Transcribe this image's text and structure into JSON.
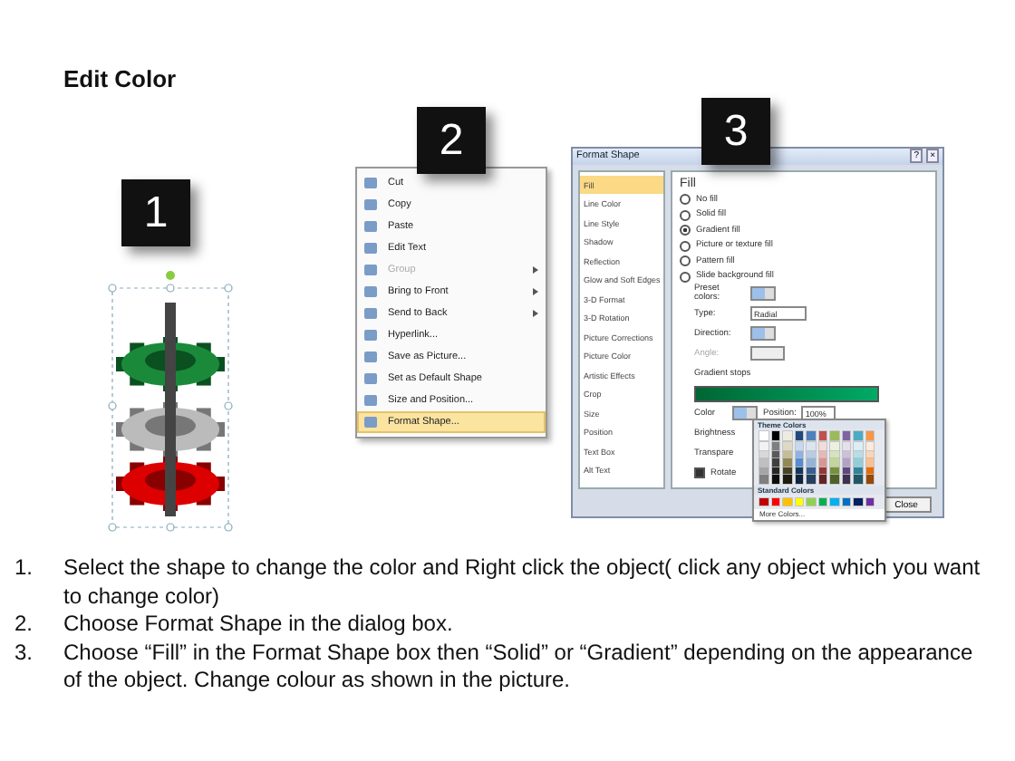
{
  "title": "Edit Color",
  "shape": {
    "badge": "1"
  },
  "context_menu": {
    "badge": "2",
    "items": [
      {
        "label": "Cut",
        "disabled": false,
        "submenu": false,
        "highlighted": false
      },
      {
        "label": "Copy",
        "disabled": false,
        "submenu": false,
        "highlighted": false
      },
      {
        "label": "Paste",
        "disabled": false,
        "submenu": false,
        "highlighted": false
      },
      {
        "label": "Edit Text",
        "disabled": false,
        "submenu": false,
        "highlighted": false
      },
      {
        "label": "Group",
        "disabled": true,
        "submenu": true,
        "highlighted": false
      },
      {
        "label": "Bring to Front",
        "disabled": false,
        "submenu": true,
        "highlighted": false
      },
      {
        "label": "Send to Back",
        "disabled": false,
        "submenu": true,
        "highlighted": false
      },
      {
        "label": "Hyperlink...",
        "disabled": false,
        "submenu": false,
        "highlighted": false
      },
      {
        "label": "Save as Picture...",
        "disabled": false,
        "submenu": false,
        "highlighted": false
      },
      {
        "label": "Set as Default Shape",
        "disabled": false,
        "submenu": false,
        "highlighted": false
      },
      {
        "label": "Size and Position...",
        "disabled": false,
        "submenu": false,
        "highlighted": false
      },
      {
        "label": "Format Shape...",
        "disabled": false,
        "submenu": false,
        "highlighted": true
      }
    ]
  },
  "dialog": {
    "badge": "3",
    "title": "Format Shape",
    "help": "?",
    "close": "×",
    "categories": [
      {
        "label": "Fill",
        "selected": true
      },
      {
        "label": "Line Color",
        "selected": false
      },
      {
        "label": "Line Style",
        "selected": false
      },
      {
        "label": "Shadow",
        "selected": false
      },
      {
        "label": "Reflection",
        "selected": false
      },
      {
        "label": "Glow and Soft Edges",
        "selected": false
      },
      {
        "label": "3-D Format",
        "selected": false
      },
      {
        "label": "3-D Rotation",
        "selected": false
      },
      {
        "label": "Picture Corrections",
        "selected": false
      },
      {
        "label": "Picture Color",
        "selected": false
      },
      {
        "label": "Artistic Effects",
        "selected": false
      },
      {
        "label": "Crop",
        "selected": false
      },
      {
        "label": "Size",
        "selected": false
      },
      {
        "label": "Position",
        "selected": false
      },
      {
        "label": "Text Box",
        "selected": false
      },
      {
        "label": "Alt Text",
        "selected": false
      }
    ],
    "section": "Fill",
    "fill_options": [
      {
        "label": "No fill",
        "selected": false
      },
      {
        "label": "Solid fill",
        "selected": false
      },
      {
        "label": "Gradient fill",
        "selected": true
      },
      {
        "label": "Picture or texture fill",
        "selected": false
      },
      {
        "label": "Pattern fill",
        "selected": false
      },
      {
        "label": "Slide background fill",
        "selected": false
      }
    ],
    "preset_label": "Preset colors:",
    "type_label": "Type:",
    "type_value": "Radial",
    "direction_label": "Direction:",
    "angle_label": "Angle:",
    "gradient_stops_label": "Gradient stops",
    "color_label": "Color",
    "position_label": "Position:",
    "position_value": "100%",
    "brightness_label": "Brightness",
    "transparency_label": "Transpare",
    "rotate": {
      "label": "Rotate",
      "checked": true
    },
    "close_button": "Close",
    "palette": {
      "theme_title": "Theme Colors",
      "theme_rows": [
        [
          {
            "color": "#ffffff"
          },
          {
            "color": "#000000"
          },
          {
            "color": "#eeece1"
          },
          {
            "color": "#1f497d"
          },
          {
            "color": "#4f81bd"
          },
          {
            "color": "#c0504d"
          },
          {
            "color": "#9bbb59"
          },
          {
            "color": "#8064a2"
          },
          {
            "color": "#4bacc6"
          },
          {
            "color": "#f79646"
          }
        ],
        [
          {
            "color": "#f2f2f2"
          },
          {
            "color": "#7f7f7f"
          },
          {
            "color": "#ddd9c3"
          },
          {
            "color": "#c6d9f0"
          },
          {
            "color": "#dbe5f1"
          },
          {
            "color": "#f2dcdb"
          },
          {
            "color": "#ebf1dd"
          },
          {
            "color": "#e5e0ec"
          },
          {
            "color": "#dbeef3"
          },
          {
            "color": "#fdeada"
          }
        ],
        [
          {
            "color": "#d8d8d8"
          },
          {
            "color": "#595959"
          },
          {
            "color": "#c4bd97"
          },
          {
            "color": "#8db3e2"
          },
          {
            "color": "#b8cce4"
          },
          {
            "color": "#e5b9b7"
          },
          {
            "color": "#d7e3bc"
          },
          {
            "color": "#ccc1d9"
          },
          {
            "color": "#b7dde8"
          },
          {
            "color": "#fbd5b5"
          }
        ],
        [
          {
            "color": "#bfbfbf"
          },
          {
            "color": "#3f3f3f"
          },
          {
            "color": "#938953"
          },
          {
            "color": "#548dd4"
          },
          {
            "color": "#95b3d7"
          },
          {
            "color": "#d99694"
          },
          {
            "color": "#c3d69b"
          },
          {
            "color": "#b2a2c7"
          },
          {
            "color": "#92cddc"
          },
          {
            "color": "#fac08f"
          }
        ],
        [
          {
            "color": "#a5a5a5"
          },
          {
            "color": "#262626"
          },
          {
            "color": "#494429"
          },
          {
            "color": "#17365d"
          },
          {
            "color": "#366092"
          },
          {
            "color": "#953734"
          },
          {
            "color": "#76923c"
          },
          {
            "color": "#5f497a"
          },
          {
            "color": "#31859b"
          },
          {
            "color": "#e36c09"
          }
        ],
        [
          {
            "color": "#7f7f7f"
          },
          {
            "color": "#0c0c0c"
          },
          {
            "color": "#1d1b10"
          },
          {
            "color": "#0f243e"
          },
          {
            "color": "#244061"
          },
          {
            "color": "#632423"
          },
          {
            "color": "#4f6128"
          },
          {
            "color": "#3f3151"
          },
          {
            "color": "#205867"
          },
          {
            "color": "#974806"
          }
        ]
      ],
      "standard_title": "Standard Colors",
      "standard": [
        {
          "color": "#c00000"
        },
        {
          "color": "#ff0000"
        },
        {
          "color": "#ffc000"
        },
        {
          "color": "#ffff00"
        },
        {
          "color": "#92d050"
        },
        {
          "color": "#00b050"
        },
        {
          "color": "#00b0f0"
        },
        {
          "color": "#0070c0"
        },
        {
          "color": "#002060"
        },
        {
          "color": "#7030a0"
        }
      ],
      "more": "More Colors..."
    }
  },
  "steps": [
    {
      "number": "1.",
      "text": "Select the shape to change the color and Right click the object( click any object which you want to change color)"
    },
    {
      "number": "2.",
      "text": "Choose Format Shape in the dialog box."
    },
    {
      "number": "3.",
      "text": "Choose “Fill” in the Format Shape box then “Solid” or “Gradient” depending on the appearance of the object. Change colour as shown in the picture."
    }
  ]
}
